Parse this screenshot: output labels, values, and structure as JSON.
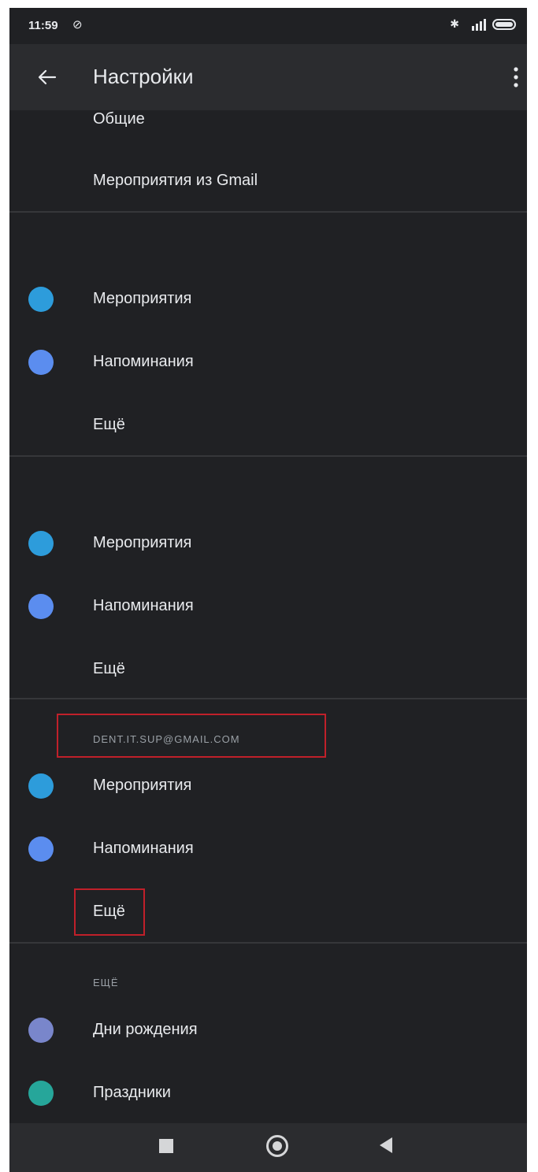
{
  "status": {
    "time": "11:59",
    "dnd_icon": "dnd-off-icon",
    "bluetooth_icon": "bluetooth-icon"
  },
  "appbar": {
    "title": "Настройки"
  },
  "general": {
    "items": [
      {
        "label": "Общие"
      },
      {
        "label": "Мероприятия из Gmail"
      }
    ]
  },
  "account1": {
    "items": [
      {
        "label": "Мероприятия",
        "color": "#2d9cdb"
      },
      {
        "label": "Напоминания",
        "color": "#5b8def"
      },
      {
        "label": "Ещё"
      }
    ]
  },
  "account2": {
    "items": [
      {
        "label": "Мероприятия",
        "color": "#2d9cdb"
      },
      {
        "label": "Напоминания",
        "color": "#5b8def"
      },
      {
        "label": "Ещё"
      }
    ]
  },
  "account3": {
    "header": "DENT.IT.SUP@GMAIL.COM",
    "items": [
      {
        "label": "Мероприятия",
        "color": "#2d9cdb"
      },
      {
        "label": "Напоминания",
        "color": "#5b8def"
      },
      {
        "label": "Ещё"
      }
    ]
  },
  "more": {
    "header": "ЕЩЁ",
    "items": [
      {
        "label": "Дни рождения",
        "color": "#7986cb"
      },
      {
        "label": "Праздники",
        "color": "#26a69a"
      }
    ]
  },
  "colors": {
    "background": "#202124",
    "appbar": "#2b2c2f",
    "text": "#e8eaed",
    "highlight": "#c0202a"
  }
}
